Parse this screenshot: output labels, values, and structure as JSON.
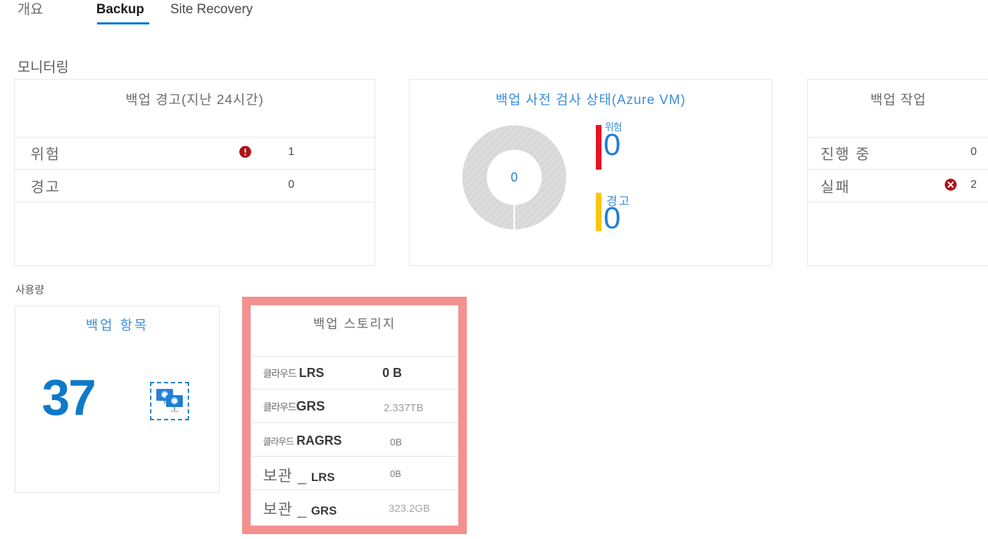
{
  "tabs": [
    {
      "label": "개요",
      "active": false
    },
    {
      "label": "Backup",
      "active": true
    },
    {
      "label": "Site Recovery",
      "active": false
    }
  ],
  "sections": {
    "monitoring": "모니터링",
    "usage": "사용량"
  },
  "colors": {
    "accent_blue": "#0078d4",
    "title_blue": "#3a8dde",
    "critical_red": "#e81123",
    "warning_yellow": "#ffc20e",
    "highlight_pink": "#f4908e",
    "icon_red": "#b01116"
  },
  "cards": {
    "alerts": {
      "title": "백업 경고(지난 24시간)",
      "rows": [
        {
          "label": "위험",
          "icon": "error-circle-icon",
          "value": "1"
        },
        {
          "label": "경고",
          "icon": null,
          "value": "0"
        }
      ]
    },
    "precheck": {
      "title": "백업 사전 검사 상태(Azure VM)",
      "donut_center_value": "0",
      "legend": [
        {
          "label": "위험",
          "value": "0",
          "color": "#e81123"
        },
        {
          "label": "경고",
          "value": "0",
          "color": "#ffc20e"
        }
      ]
    },
    "jobs": {
      "title": "백업 작업",
      "rows": [
        {
          "label": "진행 중",
          "icon": null,
          "value": "0"
        },
        {
          "label": "실패",
          "icon": "error-x-circle-icon",
          "value": "2"
        }
      ]
    },
    "items": {
      "title": "백업 항목",
      "count": "37",
      "icon": "virtual-machines-icon"
    },
    "storage": {
      "title": "백업 스토리지",
      "rows": [
        {
          "label_ko": "클라우드",
          "label_en": "LRS",
          "value": "0 B"
        },
        {
          "label_ko": "클라우드",
          "label_en": "GRS",
          "value": "2.337TB"
        },
        {
          "label_ko": "클라우드",
          "label_en": "RAGRS",
          "value": "0B"
        },
        {
          "label_ko": "보관 _",
          "label_en": "LRS",
          "value": "0B"
        },
        {
          "label_ko": "보관 _",
          "label_en": "GRS",
          "value": "323.2GB"
        }
      ]
    }
  },
  "chart_data": {
    "type": "pie",
    "title": "백업 사전 검사 상태(Azure VM)",
    "labels": [
      "위험",
      "경고"
    ],
    "values": [
      0,
      0
    ],
    "center_label": "0",
    "total": 0,
    "colors": [
      "#e81123",
      "#ffc20e"
    ],
    "empty_state": true,
    "legend_position": "right"
  }
}
